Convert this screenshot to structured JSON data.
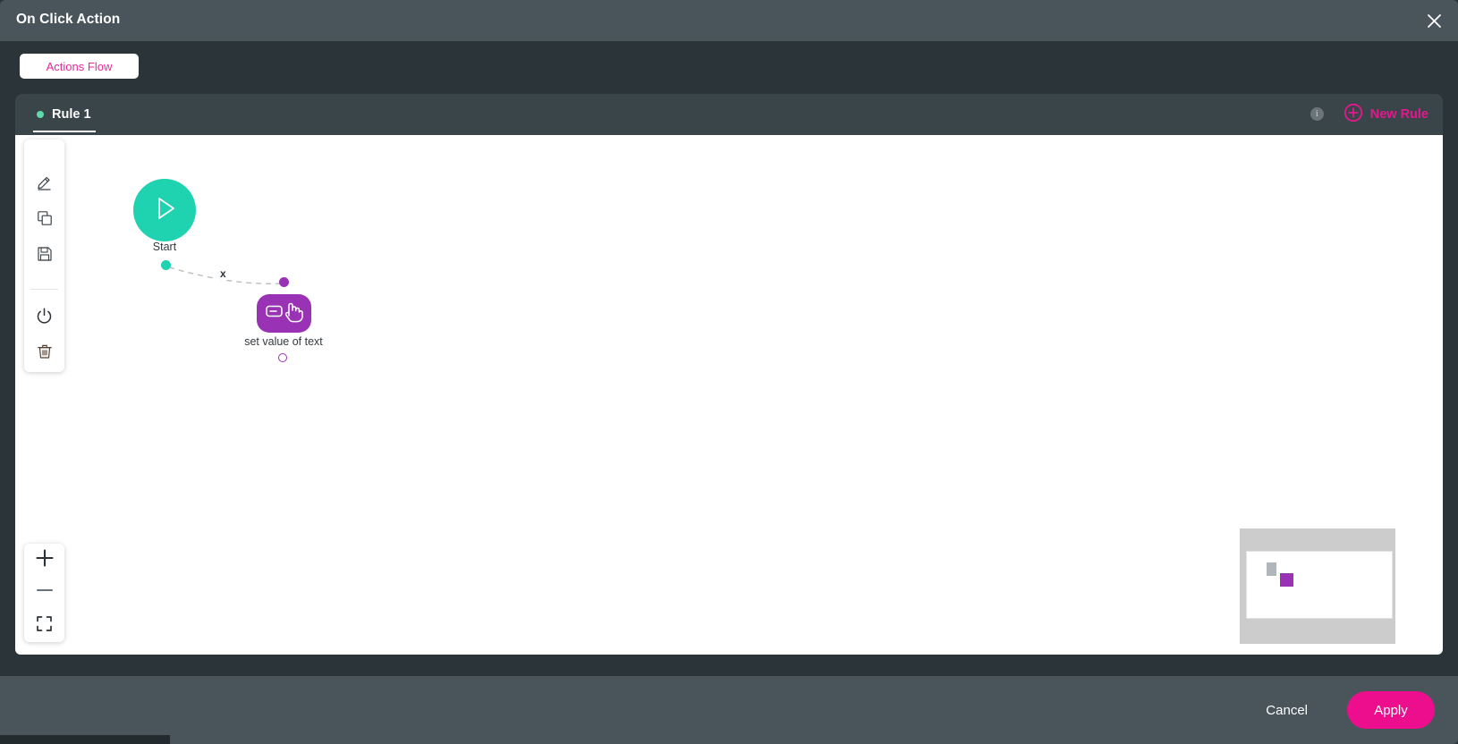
{
  "window": {
    "title": "On Click Action",
    "close_icon": "close-icon"
  },
  "flow_tab": {
    "label": "Actions Flow"
  },
  "rule_bar": {
    "tab_label": "Rule 1",
    "status_dot_color": "#5fd9a8",
    "info_icon": "info-icon",
    "info_glyph": "i",
    "new_rule_label": "New Rule",
    "new_rule_icon": "plus-circle-icon",
    "accent_color": "#e5178f"
  },
  "toolbar": {
    "items": [
      {
        "name": "edit-tool",
        "icon": "pencil-icon"
      },
      {
        "name": "duplicate-tool",
        "icon": "copy-icon"
      },
      {
        "name": "save-tool",
        "icon": "floppy-disk-icon"
      },
      {
        "name": "power-tool",
        "icon": "power-icon"
      },
      {
        "name": "delete-tool",
        "icon": "trash-icon"
      }
    ]
  },
  "zoom_controls": {
    "zoom_in_icon": "plus-icon",
    "zoom_out_icon": "minus-icon",
    "fit_icon": "fit-to-screen-icon"
  },
  "graph": {
    "start_node": {
      "label": "Start",
      "icon": "play-icon",
      "color": "#1fd2b0"
    },
    "action_node": {
      "label": "set value of text",
      "icon": "set-text-value-icon",
      "color": "#9932b4"
    },
    "edge": {
      "label": "x",
      "style": "dashed",
      "color": "#b3b8bb"
    }
  },
  "minimap": {
    "background_color": "#cccccc",
    "viewport_color": "#ffffff"
  },
  "footer": {
    "cancel_label": "Cancel",
    "apply_label": "Apply",
    "apply_color": "#ec0e8c"
  }
}
